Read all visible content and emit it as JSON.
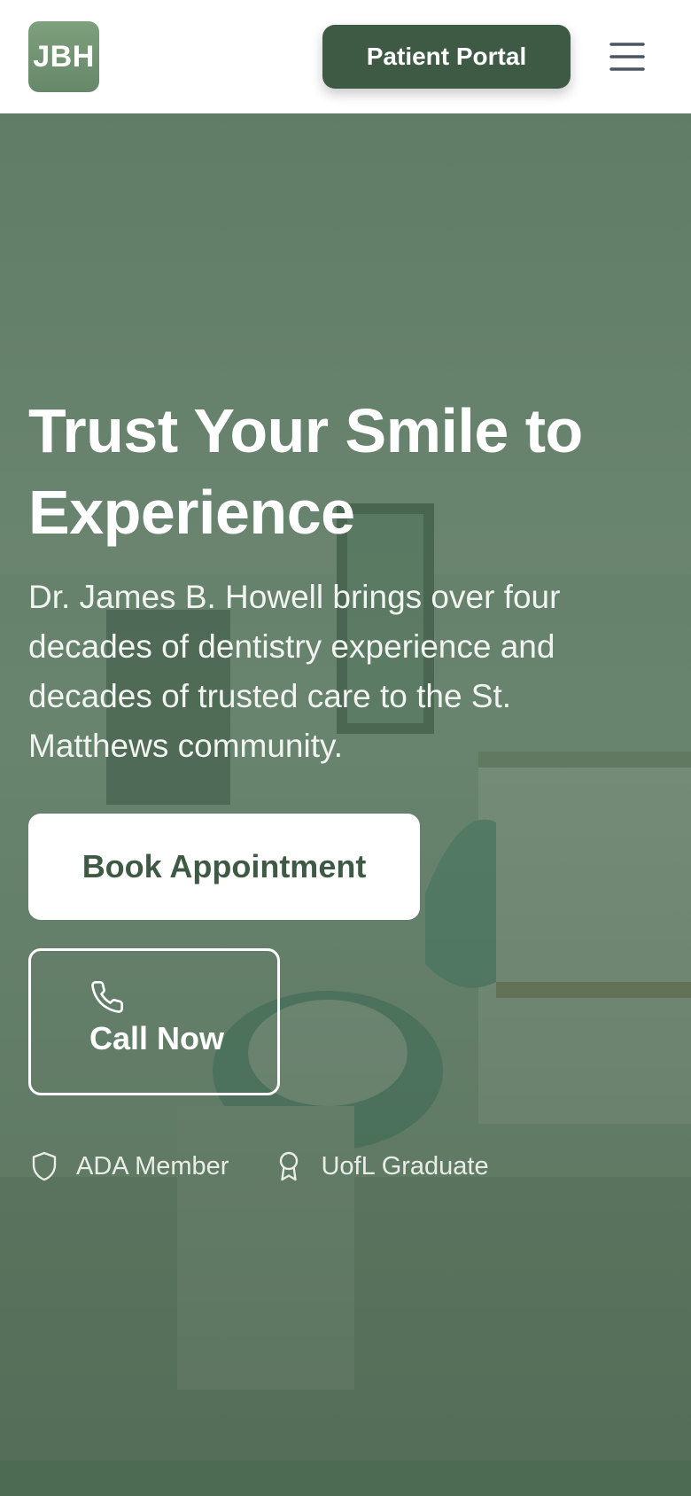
{
  "header": {
    "logo_text": "JBH",
    "portal_button": "Patient Portal"
  },
  "hero": {
    "title_line1": "Trust Your Smile to",
    "title_line2": "Experience",
    "description": "Dr. James B. Howell brings over four decades of dentistry experience and decades of trusted care to the St. Matthews community.",
    "book_button": "Book Appointment",
    "call_button": "Call Now"
  },
  "badges": [
    {
      "label": "ADA Member",
      "icon": "shield-icon"
    },
    {
      "label": "UofL Graduate",
      "icon": "award-ribbon-icon"
    }
  ],
  "colors": {
    "brand_green": "#3e5a44",
    "logo_green": "#7ea07c",
    "overlay_green": "#486850"
  }
}
